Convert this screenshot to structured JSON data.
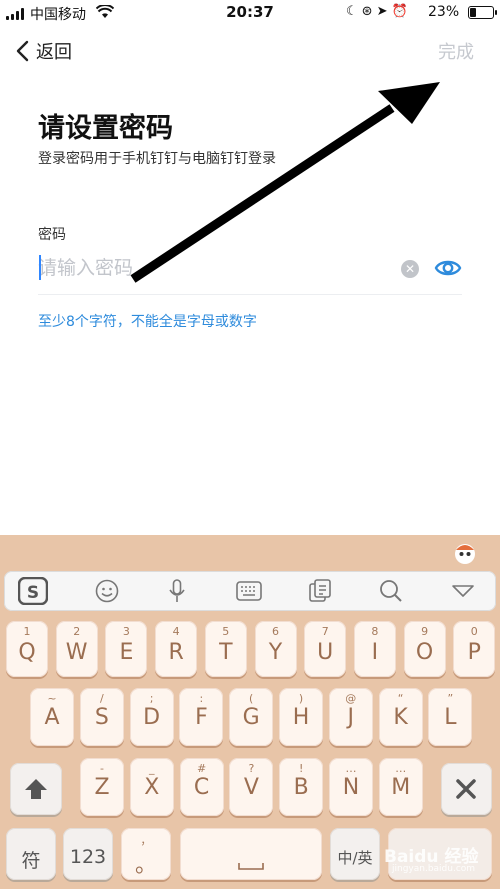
{
  "status": {
    "carrier": "中国移动",
    "time": "20:37",
    "battery": "23%"
  },
  "nav": {
    "back_label": "返回",
    "done_label": "完成"
  },
  "form": {
    "title": "请设置密码",
    "subtitle": "登录密码用于手机钉钉与电脑钉钉登录",
    "field_label": "密码",
    "placeholder": "请输入密码",
    "value": "",
    "hint": "至少8个字符，不能全是字母或数字"
  },
  "keyboard": {
    "row1": [
      {
        "main": "Q",
        "sub": "1"
      },
      {
        "main": "W",
        "sub": "2"
      },
      {
        "main": "E",
        "sub": "3"
      },
      {
        "main": "R",
        "sub": "4"
      },
      {
        "main": "T",
        "sub": "5"
      },
      {
        "main": "Y",
        "sub": "6"
      },
      {
        "main": "U",
        "sub": "7"
      },
      {
        "main": "I",
        "sub": "8"
      },
      {
        "main": "O",
        "sub": "9"
      },
      {
        "main": "P",
        "sub": "0"
      }
    ],
    "row2": [
      {
        "main": "A",
        "sub": "~"
      },
      {
        "main": "S",
        "sub": "/"
      },
      {
        "main": "D",
        "sub": ";"
      },
      {
        "main": "F",
        "sub": ":"
      },
      {
        "main": "G",
        "sub": "("
      },
      {
        "main": "H",
        "sub": ")"
      },
      {
        "main": "J",
        "sub": "@"
      },
      {
        "main": "K",
        "sub": "“"
      },
      {
        "main": "L",
        "sub": "”"
      }
    ],
    "row3": [
      {
        "main": "Z",
        "sub": "-"
      },
      {
        "main": "X",
        "sub": "_"
      },
      {
        "main": "C",
        "sub": "#"
      },
      {
        "main": "V",
        "sub": "?"
      },
      {
        "main": "B",
        "sub": "!"
      },
      {
        "main": "N",
        "sub": "…"
      },
      {
        "main": "M",
        "sub": "…"
      }
    ],
    "symbol_key": "符",
    "numeric_key": "123",
    "punct_main": "。",
    "punct_sub": "，",
    "lang_key": "中/英",
    "watermark": "Baidu 经验",
    "watermark_sub": "jingyan.baidu.com",
    "toolbar_icons": [
      "sogou-logo-icon",
      "emoji-icon",
      "microphone-icon",
      "keyboard-icon",
      "clipboard-icon",
      "search-icon",
      "collapse-keyboard-icon"
    ]
  }
}
